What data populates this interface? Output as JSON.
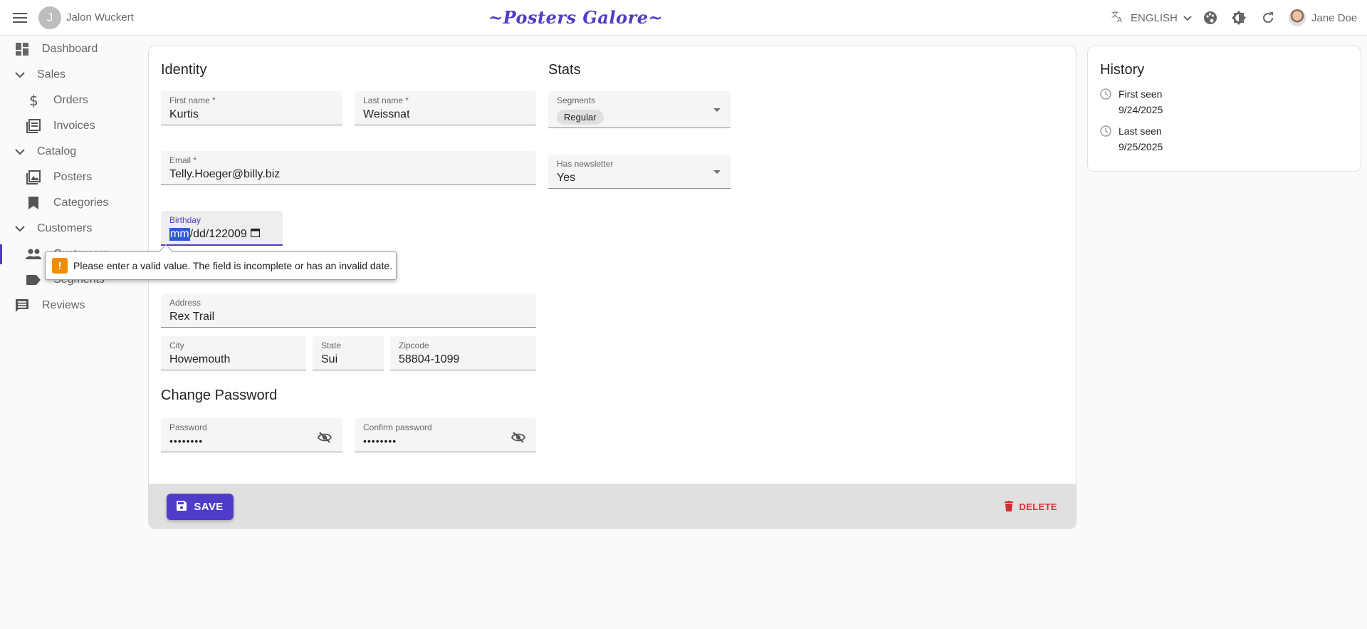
{
  "appbar": {
    "user_initial": "J",
    "user_name": "Jalon Wuckert",
    "brand": "~Posters Galore~",
    "language": "ENGLISH",
    "account_name": "Jane Doe"
  },
  "sidebar": {
    "items": [
      {
        "label": "Dashboard",
        "icon": "dashboard-icon"
      },
      {
        "label": "Sales",
        "icon": "chevron-down-icon"
      },
      {
        "label": "Orders",
        "icon": "dollar-icon"
      },
      {
        "label": "Invoices",
        "icon": "invoices-icon"
      },
      {
        "label": "Catalog",
        "icon": "chevron-down-icon"
      },
      {
        "label": "Posters",
        "icon": "image-icon"
      },
      {
        "label": "Categories",
        "icon": "bookmark-icon"
      },
      {
        "label": "Customers",
        "icon": "chevron-down-icon"
      },
      {
        "label": "Customers",
        "icon": "people-icon"
      },
      {
        "label": "Segments",
        "icon": "label-icon"
      },
      {
        "label": "Reviews",
        "icon": "comment-icon"
      }
    ]
  },
  "identity": {
    "title": "Identity",
    "first_name_label": "First name *",
    "first_name": "Kurtis",
    "last_name_label": "Last name *",
    "last_name": "Weissnat",
    "email_label": "Email *",
    "email": "Telly.Hoeger@billy.biz",
    "birthday_label": "Birthday",
    "birthday_mm": "mm",
    "birthday_rest": "/dd/122009",
    "address_label": "Address",
    "address": "Rex Trail",
    "city_label": "City",
    "city": "Howemouth",
    "state_label": "State",
    "state": "Sui",
    "zipcode_label": "Zipcode",
    "zipcode": "58804-1099"
  },
  "validation": {
    "message": "Please enter a valid value. The field is incomplete or has an invalid date."
  },
  "password": {
    "title": "Change Password",
    "password_label": "Password",
    "password_value": "••••••••",
    "confirm_label": "Confirm password",
    "confirm_value": "••••••••"
  },
  "stats": {
    "title": "Stats",
    "segments_label": "Segments",
    "segment_chip": "Regular",
    "newsletter_label": "Has newsletter",
    "newsletter_value": "Yes"
  },
  "toolbar": {
    "save_label": "SAVE",
    "delete_label": "DELETE"
  },
  "history": {
    "title": "History",
    "first_seen_label": "First seen",
    "first_seen_date": "9/24/2025",
    "last_seen_label": "Last seen",
    "last_seen_date": "9/25/2025"
  },
  "colors": {
    "primary": "#4f3cc9",
    "danger": "#d32f2f",
    "warning": "#f08c00"
  }
}
